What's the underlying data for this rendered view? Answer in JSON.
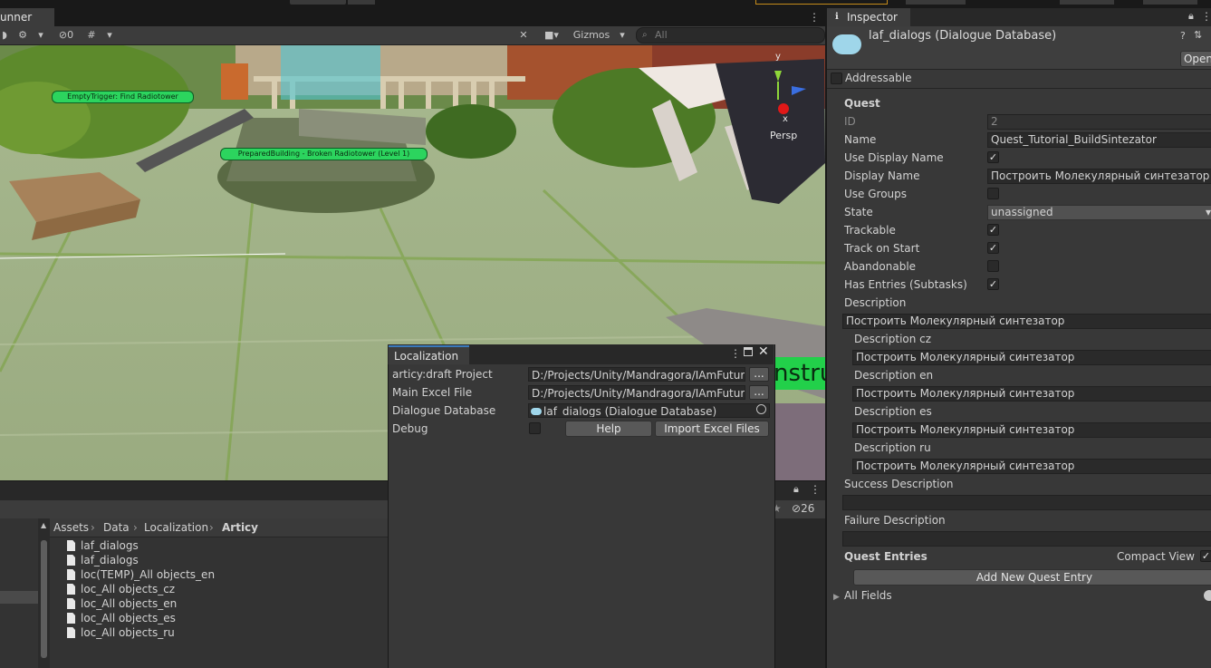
{
  "scene": {
    "tab_title": "unner",
    "toolbar": {
      "hidden_count": "0",
      "gizmos_label": "Gizmos",
      "search_placeholder": "All"
    },
    "labels": {
      "trigger": "EmptyTrigger: Find Radiotower",
      "building": "PreparedBuilding - Broken Radiotower (Level 1)",
      "persp": "Persp",
      "axis_y": "y",
      "axis_x": "x",
      "sign_text": "nstru"
    }
  },
  "project": {
    "count_badge": "26",
    "breadcrumb": [
      "Assets",
      "Data",
      "Localization",
      "Articy"
    ],
    "files": [
      "laf_dialogs",
      "laf_dialogs",
      "loc(TEMP)_All objects_en",
      "loc_All objects_cz",
      "loc_All objects_en",
      "loc_All objects_es",
      "loc_All objects_ru"
    ]
  },
  "localization": {
    "tab_title": "Localization",
    "rows": {
      "articy_label": "articy:draft Project",
      "articy_value": "D:/Projects/Unity/Mandragora/IAmFuture/",
      "excel_label": "Main Excel File",
      "excel_value": "D:/Projects/Unity/Mandragora/IAmFuture/",
      "db_label": "Dialogue Database",
      "db_value": "laf_dialogs (Dialogue Database)",
      "debug_label": "Debug",
      "dots": "..."
    },
    "buttons": {
      "help": "Help",
      "import": "Import Excel Files"
    }
  },
  "inspector": {
    "tab_title": "Inspector",
    "object_title": "laf_dialogs (Dialogue Database)",
    "open_button": "Open",
    "addressable_label": "Addressable",
    "section_quest": "Quest",
    "fields": {
      "id_label": "ID",
      "id_value": "2",
      "name_label": "Name",
      "name_value": "Quest_Tutorial_BuildSintezator",
      "use_display_name_label": "Use Display Name",
      "display_name_label": "Display Name",
      "display_name_value": "Построить Молекулярный синтезатор",
      "use_groups_label": "Use Groups",
      "state_label": "State",
      "state_value": "unassigned",
      "trackable_label": "Trackable",
      "track_on_start_label": "Track on Start",
      "abandonable_label": "Abandonable",
      "has_entries_label": "Has Entries (Subtasks)",
      "description_label": "Description",
      "description_value": "Построить Молекулярный синтезатор",
      "desc_cz_label": "Description cz",
      "desc_cz_value": "Построить Молекулярный синтезатор",
      "desc_en_label": "Description en",
      "desc_en_value": "Построить Молекулярный синтезатор",
      "desc_es_label": "Description es",
      "desc_es_value": "Построить Молекулярный синтезатор",
      "desc_ru_label": "Description ru",
      "desc_ru_value": "Построить Молекулярный синтезатор",
      "success_label": "Success Description",
      "failure_label": "Failure Description"
    },
    "quest_entries_label": "Quest Entries",
    "compact_view_label": "Compact View",
    "add_entry_button": "Add New Quest Entry",
    "all_fields_label": "All Fields",
    "check_mark": "✓"
  },
  "colors": {
    "accent": "#3a79bb",
    "sign_green": "#22d04a",
    "label_green": "#2cd45e"
  }
}
